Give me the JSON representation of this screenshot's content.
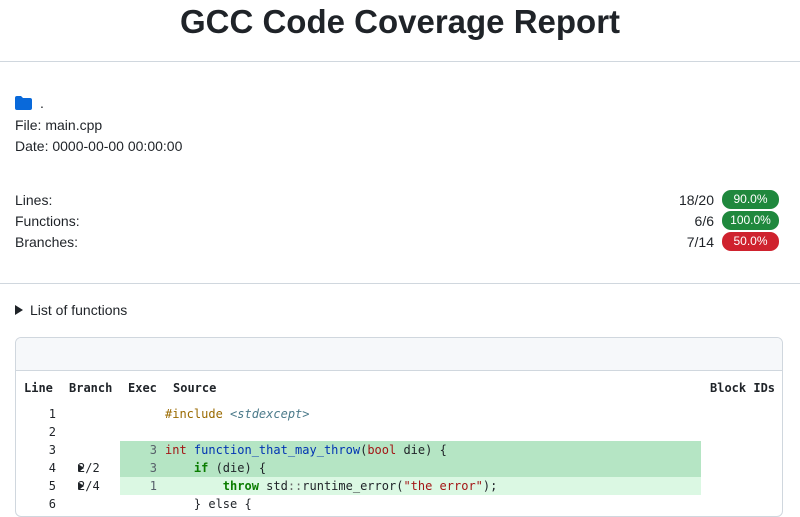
{
  "header": {
    "title": "GCC Code Coverage Report"
  },
  "info": {
    "directory": ".",
    "file_label": "File:",
    "file_value": "main.cpp",
    "date_label": "Date:",
    "date_value": "0000-00-00 00:00:00"
  },
  "summary": {
    "rows": [
      {
        "label": "Lines:",
        "value": "18/20",
        "percent": "90.0%",
        "color": "#1f883d"
      },
      {
        "label": "Functions:",
        "value": "6/6",
        "percent": "100.0%",
        "color": "#1f883d"
      },
      {
        "label": "Branches:",
        "value": "7/14",
        "percent": "50.0%",
        "color": "#cf222e"
      }
    ]
  },
  "functions": {
    "toggle_label": "List of functions"
  },
  "source": {
    "columns": {
      "line": "Line",
      "branch": "Branch",
      "exec": "Exec",
      "source": "Source",
      "block_ids": "Block IDs"
    },
    "lines": [
      {
        "line": "1",
        "branch": "",
        "exec": "",
        "coverage": "none",
        "tokens": [
          {
            "t": "#include ",
            "c": "pp"
          },
          {
            "t": "<stdexcept>",
            "c": "hd"
          }
        ]
      },
      {
        "line": "2",
        "branch": "",
        "exec": "",
        "coverage": "none",
        "tokens": []
      },
      {
        "line": "3",
        "branch": "",
        "exec": "3",
        "coverage": "covered",
        "tokens": [
          {
            "t": "int ",
            "c": "ty"
          },
          {
            "t": "function_that_may_throw",
            "c": "fn"
          },
          {
            "t": "(",
            "c": ""
          },
          {
            "t": "bool",
            "c": "ty"
          },
          {
            "t": " die) {",
            "c": ""
          }
        ]
      },
      {
        "line": "4",
        "branch": "2/2",
        "exec": "3",
        "coverage": "covered",
        "tokens": [
          {
            "t": "    ",
            "c": ""
          },
          {
            "t": "if",
            "c": "kw"
          },
          {
            "t": " (die) {",
            "c": ""
          }
        ]
      },
      {
        "line": "5",
        "branch": "2/4",
        "exec": "1",
        "coverage": "partial",
        "tokens": [
          {
            "t": "        ",
            "c": ""
          },
          {
            "t": "throw",
            "c": "kw"
          },
          {
            "t": " std",
            "c": ""
          },
          {
            "t": "::",
            "c": "op"
          },
          {
            "t": "runtime_error(",
            "c": ""
          },
          {
            "t": "\"the error\"",
            "c": "st"
          },
          {
            "t": ");",
            "c": ""
          }
        ]
      },
      {
        "line": "6",
        "branch": "",
        "exec": "",
        "coverage": "none",
        "tokens": [
          {
            "t": "    } else {",
            "c": ""
          }
        ]
      }
    ],
    "colors": {
      "covered": "#b5e5c4",
      "partial": "#dbf8e3"
    }
  }
}
